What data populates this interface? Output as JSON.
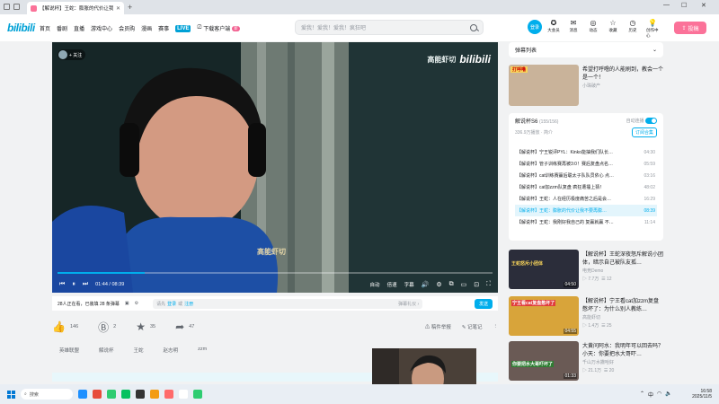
{
  "browser": {
    "tab_title": "【解说杯】王蛇：膨胀的代价让我不要…",
    "new_tab": "+",
    "window_controls": [
      "—",
      "☐",
      "✕"
    ]
  },
  "header": {
    "logo": "bilibili",
    "nav": [
      "首页",
      "番剧",
      "直播",
      "游戏中心",
      "会员购",
      "漫画",
      "赛事"
    ],
    "nav_live_badge": "LIVE",
    "download_label": "下载客户端",
    "download_badge": "新",
    "search_placeholder": "爱我！爱我！爱我！疯狂吧",
    "login_label": "登录",
    "icons": [
      {
        "glyph": "✪",
        "label": "大会员"
      },
      {
        "glyph": "✉",
        "label": "消息"
      },
      {
        "glyph": "◎",
        "label": "动态"
      },
      {
        "glyph": "☆",
        "label": "收藏"
      },
      {
        "glyph": "◷",
        "label": "历史"
      },
      {
        "glyph": "💡",
        "label": "创作中心"
      }
    ],
    "upload_label": "投稿"
  },
  "player": {
    "follow_label": "+ 关注",
    "watermark_text": "高能虾切",
    "watermark_logo": "bilibili",
    "in_video_text": "高能虾切",
    "time_current": "01:44",
    "time_total": "08:39",
    "progress_fraction": 0.2,
    "quality_label": "自动",
    "speed_label": "倍速",
    "subtitle_label": "字幕"
  },
  "danmaku_bar": {
    "viewers": "28人正在看，已装填 28 条弹幕",
    "input_prefix": "请先",
    "login_link": "登录",
    "input_or": "或",
    "register_link": "注册",
    "etiquette": "弹幕礼仪 ›",
    "send_label": "发送"
  },
  "actions": {
    "like_count": "146",
    "coin_count": "2",
    "fav_count": "35",
    "share_count": "47",
    "report_label": "稿件举报",
    "note_label": "记笔记"
  },
  "tags": [
    "英雄联盟",
    "解说杯",
    "王蛇",
    "赵志明",
    "zzm"
  ],
  "sidebar": {
    "danmaku_list_title": "弹幕列表",
    "featured": {
      "title": "希望打呼噜的人能刷到，教会一个是一个！",
      "author": "小珠破产",
      "thumb_caption": "打呼噜"
    },
    "playlist": {
      "title": "解说杯S6",
      "count": "(155/156)",
      "autoplay_label": "自动连播",
      "stats": "336.9万播放 · 简介",
      "subscribe_label": "订阅合集",
      "items": [
        {
          "title": "【解说杯】宁王锐评PYL：Kinko能抽我们队长…",
          "duration": "04:30"
        },
        {
          "title": "【解说杯】管子训练赛再被3:0！赛后复盘点名…",
          "duration": "05:59"
        },
        {
          "title": "【解说杯】cat训练赛赢后聪太子队队员依心 点…",
          "duration": "03:16"
        },
        {
          "title": "【解说杯】cat加zzm队复盘 疯狂遭捶上猜！",
          "duration": "48:02"
        },
        {
          "title": "【解说杯】王蛇：人在经历极度痛苦之后是会…",
          "duration": "16:29"
        },
        {
          "title": "【解说杯】王蛇：膨胀的代价让我不要再膨…",
          "duration": "08:39"
        },
        {
          "title": "【解说杯】王蛇：我刚好我自己的 复赢就赢 不…",
          "duration": "11:14"
        }
      ]
    },
    "recommended": [
      {
        "title": "【解说杯】王蛇深夜怒斥解说小团体，暗示自己被队友孤…",
        "author": "电竞Demo",
        "plays": "7.7万",
        "comments": "12",
        "duration": "04:50",
        "caption": "王蛇怒斥小团体"
      },
      {
        "title": "【解说杯】宁王看cat加zzm复盘憋坏了：为什么别人教练…",
        "author": "高能虾切",
        "plays": "1.4万",
        "comments": "25",
        "duration": "04:55",
        "caption": "宁王看cat复盘憋坏了"
      },
      {
        "title": "大黄问阿水：我明年可以回去吗？小天：你要把水大哥吓…",
        "author": "千山万水撒哈好",
        "plays": "21.1万",
        "comments": "20",
        "duration": "01:33",
        "caption": "你要把水大哥吓坏了"
      }
    ]
  },
  "taskbar": {
    "search_placeholder": "搜索",
    "time": "16:58",
    "date": "2025/11/5",
    "tray_lang": "中",
    "app_colors": [
      "#1e90ff",
      "#e74c3c",
      "#2ecc71",
      "#07c160",
      "#333333",
      "#f39c12",
      "#ff6b6b",
      "#ffffff",
      "#2ecc71"
    ]
  },
  "colors": {
    "accent": "#00aeec",
    "pink": "#fb7299"
  }
}
